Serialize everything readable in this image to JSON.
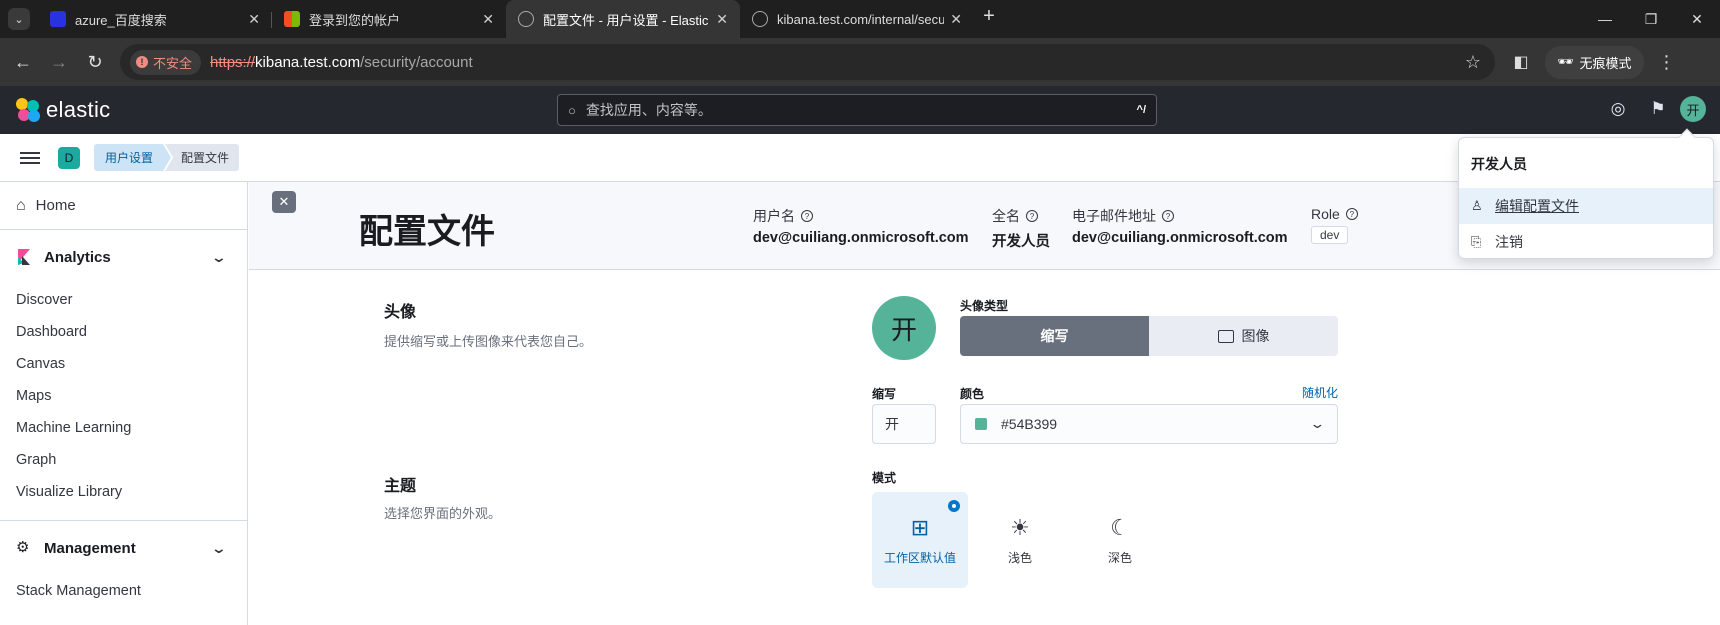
{
  "browser": {
    "tabs": [
      {
        "title": "azure_百度搜索",
        "favicon_color": "#2932e1",
        "active": false
      },
      {
        "title": "登录到您的帐户",
        "favicon_color": "#f25022",
        "active": false
      },
      {
        "title": "配置文件 - 用户设置 - Elastic",
        "favicon_color": "#888888",
        "active": true
      },
      {
        "title": "kibana.test.com/internal/secu",
        "favicon_color": "#888888",
        "active": false
      }
    ],
    "insecure_label": "不安全",
    "url_scheme": "https://",
    "url_host": "kibana.test.com",
    "url_path": "/security/account",
    "incognito_label": "无痕模式"
  },
  "header": {
    "logo_text": "elastic",
    "search_placeholder": "查找应用、内容等。",
    "search_shortcut": "^/",
    "avatar_initial": "开"
  },
  "breadcrumbs": {
    "space_letter": "D",
    "items": [
      "用户设置",
      "配置文件"
    ]
  },
  "sidenav": {
    "home": "Home",
    "analytics_label": "Analytics",
    "analytics_items": [
      "Discover",
      "Dashboard",
      "Canvas",
      "Maps",
      "Machine Learning",
      "Graph",
      "Visualize Library"
    ],
    "management_label": "Management",
    "management_items": [
      "Stack Management"
    ]
  },
  "profile_header": {
    "title": "配置文件",
    "username_label": "用户名",
    "username": "dev@cuiliang.onmicrosoft.com",
    "fullname_label": "全名",
    "fullname": "开发人员",
    "email_label": "电子邮件地址",
    "email": "dev@cuiliang.onmicrosoft.com",
    "role_label": "Role",
    "role": "dev"
  },
  "avatar_section": {
    "title": "头像",
    "description": "提供缩写或上传图像来代表您自己。",
    "avatar_initial": "开",
    "avatar_color": "#54B399",
    "type_label": "头像类型",
    "type_initials": "缩写",
    "type_image": "图像",
    "initials_label": "缩写",
    "initials_value": "开",
    "color_label": "颜色",
    "randomize": "随机化",
    "color_value": "#54B399"
  },
  "theme_section": {
    "title": "主题",
    "description": "选择您界面的外观。",
    "mode_label": "模式",
    "modes": [
      "工作区默认值",
      "浅色",
      "深色"
    ]
  },
  "user_menu": {
    "name": "开发人员",
    "edit_profile": "编辑配置文件",
    "logout": "注销"
  }
}
